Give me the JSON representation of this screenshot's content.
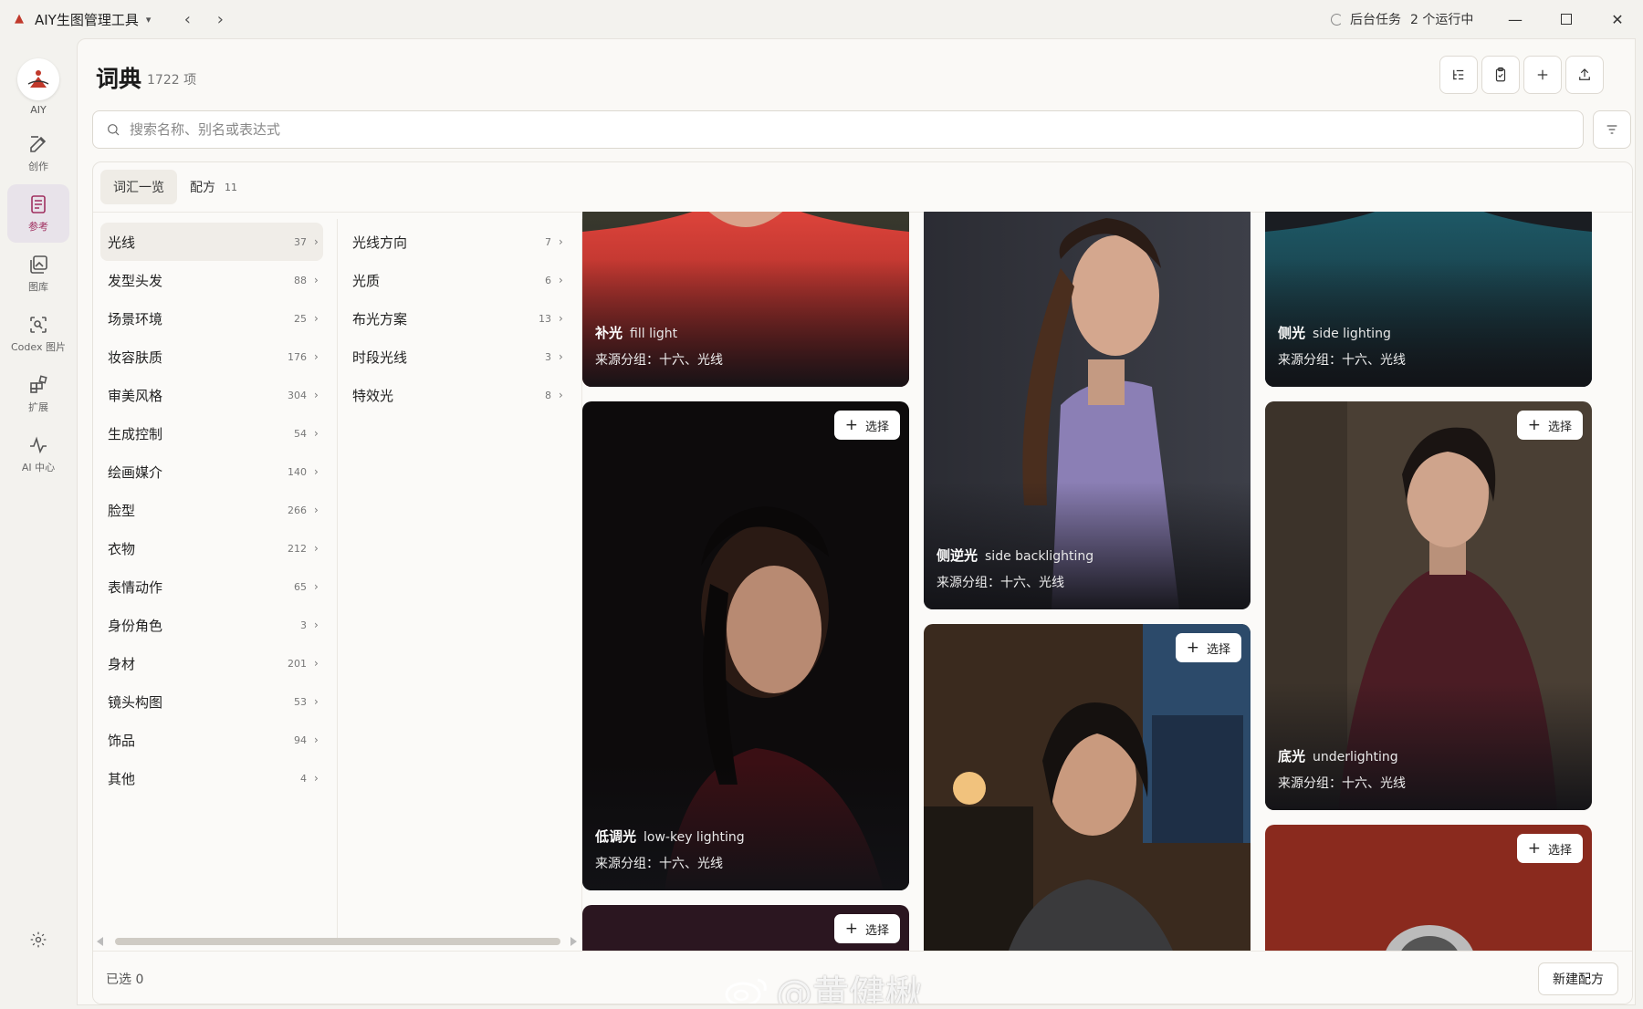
{
  "window": {
    "app_title": "AIY生图管理工具",
    "task_label": "后台任务",
    "task_count": "2 个运行中"
  },
  "sidebar": {
    "logo_label": "AIY",
    "items": [
      {
        "label": "创作",
        "icon": "edit-icon"
      },
      {
        "label": "参考",
        "icon": "document-icon",
        "active": true
      },
      {
        "label": "图库",
        "icon": "gallery-icon"
      },
      {
        "label": "Codex 图片",
        "icon": "image-search-icon"
      },
      {
        "label": "扩展",
        "icon": "extensions-icon"
      },
      {
        "label": "AI 中心",
        "icon": "activity-icon"
      }
    ]
  },
  "header": {
    "title": "词典",
    "count": "1722 项"
  },
  "search": {
    "value": "",
    "placeholder": "搜索名称、别名或表达式"
  },
  "tabs": [
    {
      "label": "词汇一览",
      "count": "",
      "active": true
    },
    {
      "label": "配方",
      "count": "11",
      "active": false
    }
  ],
  "categories": [
    {
      "name": "光线",
      "count": "37",
      "active": true
    },
    {
      "name": "发型头发",
      "count": "88"
    },
    {
      "name": "场景环境",
      "count": "25"
    },
    {
      "name": "妆容肤质",
      "count": "176"
    },
    {
      "name": "审美风格",
      "count": "304"
    },
    {
      "name": "生成控制",
      "count": "54"
    },
    {
      "name": "绘画媒介",
      "count": "140"
    },
    {
      "name": "脸型",
      "count": "266"
    },
    {
      "name": "衣物",
      "count": "212"
    },
    {
      "name": "表情动作",
      "count": "65"
    },
    {
      "name": "身份角色",
      "count": "3"
    },
    {
      "name": "身材",
      "count": "201"
    },
    {
      "name": "镜头构图",
      "count": "53"
    },
    {
      "name": "饰品",
      "count": "94"
    },
    {
      "name": "其他",
      "count": "4"
    }
  ],
  "subcategories": [
    {
      "name": "光线方向",
      "count": "7"
    },
    {
      "name": "光质",
      "count": "6"
    },
    {
      "name": "布光方案",
      "count": "13"
    },
    {
      "name": "时段光线",
      "count": "3"
    },
    {
      "name": "特效光",
      "count": "8"
    }
  ],
  "pick_label": "选择",
  "cards": [
    {
      "title": "补光",
      "en": "fill light",
      "source": "来源分组：十六、光线"
    },
    {
      "title": "侧逆光",
      "en": "side backlighting",
      "source": "来源分组：十六、光线"
    },
    {
      "title": "侧光",
      "en": "side lighting",
      "source": "来源分组：十六、光线"
    },
    {
      "title": "低调光",
      "en": "low-key lighting",
      "source": "来源分组：十六、光线"
    },
    {
      "title": "底光",
      "en": "underlighting",
      "source": "来源分组：十六、光线"
    }
  ],
  "footer": {
    "selected": "已选 0",
    "new_recipe": "新建配方",
    "watermark": "@黄健楸"
  },
  "colors": {
    "accent": "#a03060",
    "card_red": "#c9302c",
    "card_teal": "#1e4f5c"
  }
}
